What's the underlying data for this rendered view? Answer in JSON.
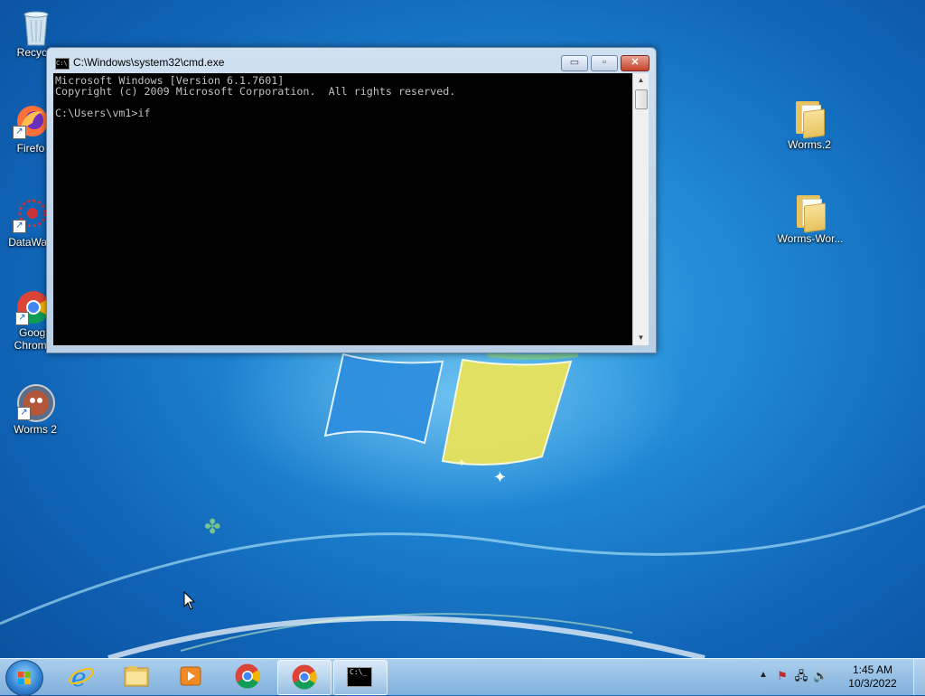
{
  "desktop": {
    "icons_left": [
      {
        "label": "Recycle",
        "icon": "recycle-bin-icon"
      },
      {
        "label": "Firefo",
        "icon": "firefox-icon"
      },
      {
        "label": "DataWag",
        "icon": "datawag-icon"
      },
      {
        "label": "Googl\nChrome",
        "icon": "chrome-icon"
      },
      {
        "label": "Worms 2",
        "icon": "worms-icon"
      }
    ],
    "icons_right": [
      {
        "label": "Worms.2",
        "icon": "folder-icon"
      },
      {
        "label": "Worms-Wor...",
        "icon": "folder-icon"
      }
    ]
  },
  "window": {
    "title": "C:\\Windows\\system32\\cmd.exe",
    "icon_text": "C:\\",
    "minimize_label": "▭",
    "maximize_label": "▫",
    "close_label": "✕",
    "console_text": "Microsoft Windows [Version 6.1.7601]\nCopyright (c) 2009 Microsoft Corporation.  All rights reserved.\n\nC:\\Users\\vm1>if"
  },
  "taskbar": {
    "items": [
      {
        "name": "internet-explorer",
        "icon": "ie-icon",
        "active": false
      },
      {
        "name": "file-explorer",
        "icon": "folder-icon",
        "active": false
      },
      {
        "name": "media-player",
        "icon": "media-player-icon",
        "active": false
      },
      {
        "name": "chrome-pinned",
        "icon": "chrome-icon",
        "active": false
      },
      {
        "name": "chrome-running",
        "icon": "chrome-icon",
        "active": true
      },
      {
        "name": "cmd-running",
        "icon": "cmd-icon",
        "active": true
      }
    ],
    "cmd_icon_text": "C:\\_",
    "tray": {
      "time": "1:45 AM",
      "date": "10/3/2022",
      "arrow": "▲",
      "flag_icon": "⚑",
      "network_icon": "🖧",
      "volume_icon": "🔊"
    }
  },
  "colors": {
    "console_bg": "#000000",
    "console_fg": "#c0c0c0",
    "close_red": "#c4412a"
  }
}
